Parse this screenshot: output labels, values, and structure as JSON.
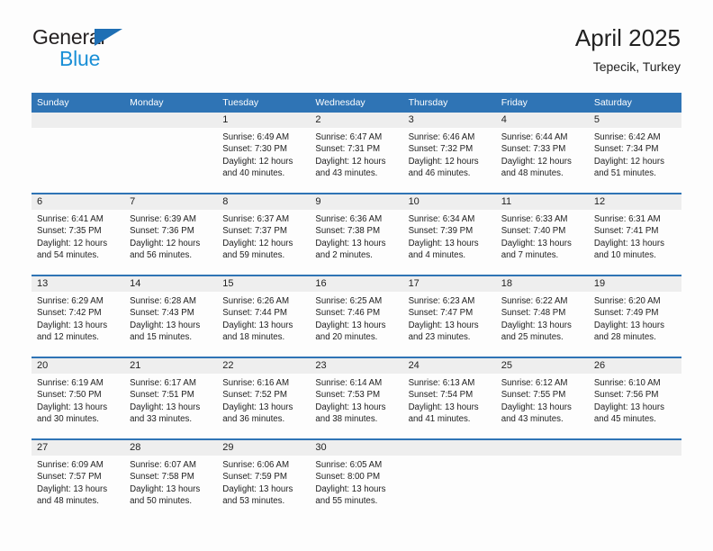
{
  "brand": {
    "name_part1": "General",
    "name_part2": "Blue",
    "flag_icon": "triangle-flag-icon"
  },
  "header": {
    "title": "April 2025",
    "subtitle": "Tepecik, Turkey"
  },
  "colors": {
    "header_blue": "#2f74b5",
    "brand_blue": "#1a8fd6",
    "flag_blue": "#1f6fb4",
    "daynum_band": "#eeeeee",
    "text": "#222222"
  },
  "weekday_headers": [
    "Sunday",
    "Monday",
    "Tuesday",
    "Wednesday",
    "Thursday",
    "Friday",
    "Saturday"
  ],
  "weeks": [
    [
      {
        "day": "",
        "lines": []
      },
      {
        "day": "",
        "lines": []
      },
      {
        "day": "1",
        "lines": [
          "Sunrise: 6:49 AM",
          "Sunset: 7:30 PM",
          "Daylight: 12 hours",
          "and 40 minutes."
        ]
      },
      {
        "day": "2",
        "lines": [
          "Sunrise: 6:47 AM",
          "Sunset: 7:31 PM",
          "Daylight: 12 hours",
          "and 43 minutes."
        ]
      },
      {
        "day": "3",
        "lines": [
          "Sunrise: 6:46 AM",
          "Sunset: 7:32 PM",
          "Daylight: 12 hours",
          "and 46 minutes."
        ]
      },
      {
        "day": "4",
        "lines": [
          "Sunrise: 6:44 AM",
          "Sunset: 7:33 PM",
          "Daylight: 12 hours",
          "and 48 minutes."
        ]
      },
      {
        "day": "5",
        "lines": [
          "Sunrise: 6:42 AM",
          "Sunset: 7:34 PM",
          "Daylight: 12 hours",
          "and 51 minutes."
        ]
      }
    ],
    [
      {
        "day": "6",
        "lines": [
          "Sunrise: 6:41 AM",
          "Sunset: 7:35 PM",
          "Daylight: 12 hours",
          "and 54 minutes."
        ]
      },
      {
        "day": "7",
        "lines": [
          "Sunrise: 6:39 AM",
          "Sunset: 7:36 PM",
          "Daylight: 12 hours",
          "and 56 minutes."
        ]
      },
      {
        "day": "8",
        "lines": [
          "Sunrise: 6:37 AM",
          "Sunset: 7:37 PM",
          "Daylight: 12 hours",
          "and 59 minutes."
        ]
      },
      {
        "day": "9",
        "lines": [
          "Sunrise: 6:36 AM",
          "Sunset: 7:38 PM",
          "Daylight: 13 hours",
          "and 2 minutes."
        ]
      },
      {
        "day": "10",
        "lines": [
          "Sunrise: 6:34 AM",
          "Sunset: 7:39 PM",
          "Daylight: 13 hours",
          "and 4 minutes."
        ]
      },
      {
        "day": "11",
        "lines": [
          "Sunrise: 6:33 AM",
          "Sunset: 7:40 PM",
          "Daylight: 13 hours",
          "and 7 minutes."
        ]
      },
      {
        "day": "12",
        "lines": [
          "Sunrise: 6:31 AM",
          "Sunset: 7:41 PM",
          "Daylight: 13 hours",
          "and 10 minutes."
        ]
      }
    ],
    [
      {
        "day": "13",
        "lines": [
          "Sunrise: 6:29 AM",
          "Sunset: 7:42 PM",
          "Daylight: 13 hours",
          "and 12 minutes."
        ]
      },
      {
        "day": "14",
        "lines": [
          "Sunrise: 6:28 AM",
          "Sunset: 7:43 PM",
          "Daylight: 13 hours",
          "and 15 minutes."
        ]
      },
      {
        "day": "15",
        "lines": [
          "Sunrise: 6:26 AM",
          "Sunset: 7:44 PM",
          "Daylight: 13 hours",
          "and 18 minutes."
        ]
      },
      {
        "day": "16",
        "lines": [
          "Sunrise: 6:25 AM",
          "Sunset: 7:46 PM",
          "Daylight: 13 hours",
          "and 20 minutes."
        ]
      },
      {
        "day": "17",
        "lines": [
          "Sunrise: 6:23 AM",
          "Sunset: 7:47 PM",
          "Daylight: 13 hours",
          "and 23 minutes."
        ]
      },
      {
        "day": "18",
        "lines": [
          "Sunrise: 6:22 AM",
          "Sunset: 7:48 PM",
          "Daylight: 13 hours",
          "and 25 minutes."
        ]
      },
      {
        "day": "19",
        "lines": [
          "Sunrise: 6:20 AM",
          "Sunset: 7:49 PM",
          "Daylight: 13 hours",
          "and 28 minutes."
        ]
      }
    ],
    [
      {
        "day": "20",
        "lines": [
          "Sunrise: 6:19 AM",
          "Sunset: 7:50 PM",
          "Daylight: 13 hours",
          "and 30 minutes."
        ]
      },
      {
        "day": "21",
        "lines": [
          "Sunrise: 6:17 AM",
          "Sunset: 7:51 PM",
          "Daylight: 13 hours",
          "and 33 minutes."
        ]
      },
      {
        "day": "22",
        "lines": [
          "Sunrise: 6:16 AM",
          "Sunset: 7:52 PM",
          "Daylight: 13 hours",
          "and 36 minutes."
        ]
      },
      {
        "day": "23",
        "lines": [
          "Sunrise: 6:14 AM",
          "Sunset: 7:53 PM",
          "Daylight: 13 hours",
          "and 38 minutes."
        ]
      },
      {
        "day": "24",
        "lines": [
          "Sunrise: 6:13 AM",
          "Sunset: 7:54 PM",
          "Daylight: 13 hours",
          "and 41 minutes."
        ]
      },
      {
        "day": "25",
        "lines": [
          "Sunrise: 6:12 AM",
          "Sunset: 7:55 PM",
          "Daylight: 13 hours",
          "and 43 minutes."
        ]
      },
      {
        "day": "26",
        "lines": [
          "Sunrise: 6:10 AM",
          "Sunset: 7:56 PM",
          "Daylight: 13 hours",
          "and 45 minutes."
        ]
      }
    ],
    [
      {
        "day": "27",
        "lines": [
          "Sunrise: 6:09 AM",
          "Sunset: 7:57 PM",
          "Daylight: 13 hours",
          "and 48 minutes."
        ]
      },
      {
        "day": "28",
        "lines": [
          "Sunrise: 6:07 AM",
          "Sunset: 7:58 PM",
          "Daylight: 13 hours",
          "and 50 minutes."
        ]
      },
      {
        "day": "29",
        "lines": [
          "Sunrise: 6:06 AM",
          "Sunset: 7:59 PM",
          "Daylight: 13 hours",
          "and 53 minutes."
        ]
      },
      {
        "day": "30",
        "lines": [
          "Sunrise: 6:05 AM",
          "Sunset: 8:00 PM",
          "Daylight: 13 hours",
          "and 55 minutes."
        ]
      },
      {
        "day": "",
        "lines": []
      },
      {
        "day": "",
        "lines": []
      },
      {
        "day": "",
        "lines": []
      }
    ]
  ]
}
